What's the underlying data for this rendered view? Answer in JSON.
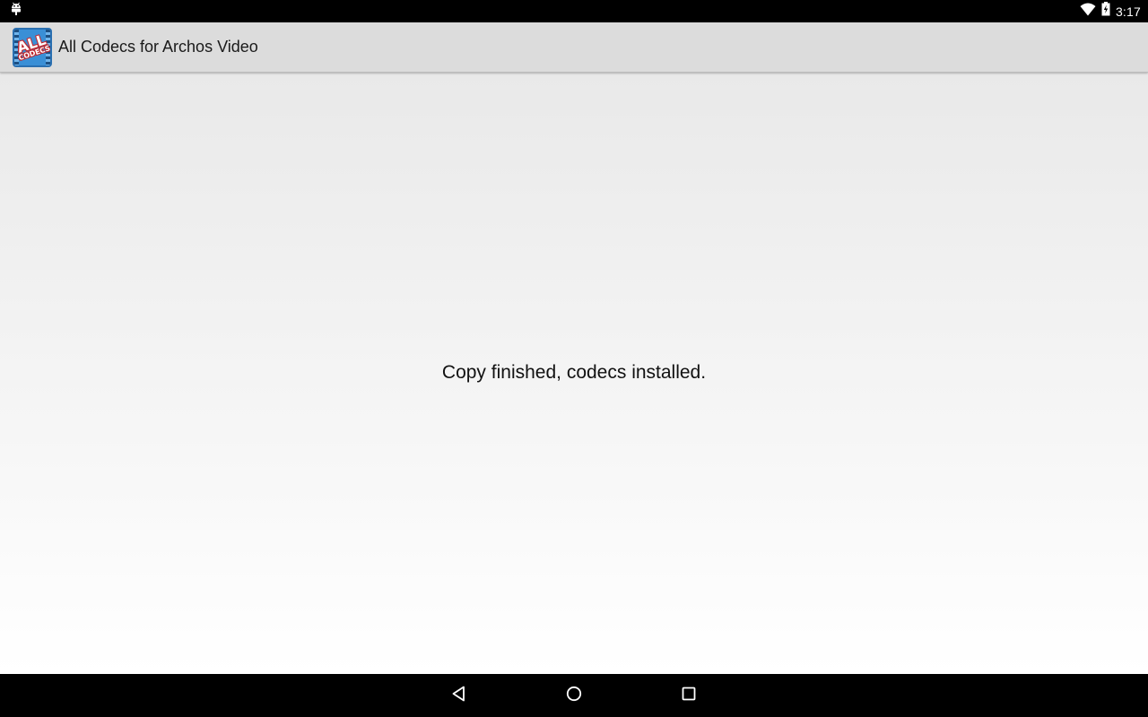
{
  "status_bar": {
    "time": "3:17",
    "icons": [
      "android-debug-icon",
      "wifi-icon",
      "battery-charging-icon"
    ]
  },
  "action_bar": {
    "app_icon": {
      "name": "all-codecs-app-icon",
      "text_line1": "ALL",
      "text_line2": "CODECS"
    },
    "title": "All Codecs for Archos Video"
  },
  "main": {
    "message": "Copy finished, codecs installed."
  },
  "nav_bar": {
    "buttons": [
      "back",
      "home",
      "recents"
    ]
  },
  "colors": {
    "status_bar_bg": "#000000",
    "action_bar_bg": "#dcdcdc",
    "icon_blue": "#3a8fd6",
    "icon_red": "#c0262d"
  }
}
